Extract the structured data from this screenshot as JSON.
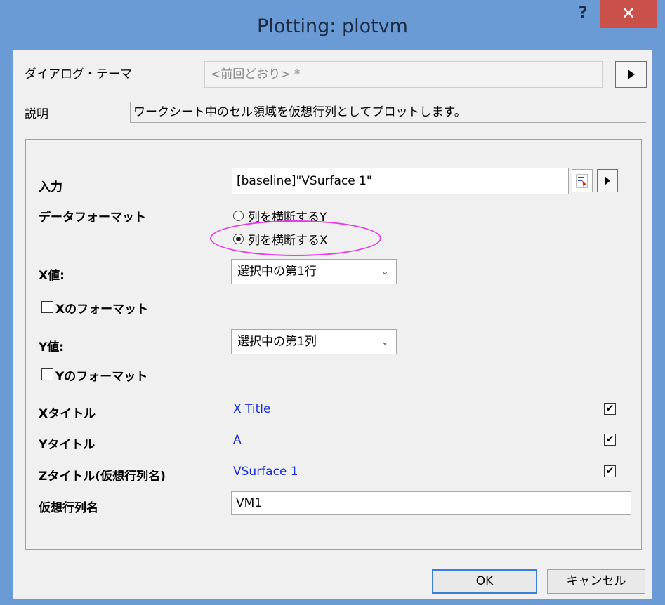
{
  "window": {
    "title": "Plotting: plotvm",
    "help_label": "?",
    "close_label": "✕"
  },
  "theme": {
    "label": "ダイアログ・テーマ",
    "value": "<前回どおり> *",
    "arrow_icon": "play-arrow-icon"
  },
  "description": {
    "label": "説明",
    "text": "ワークシート中のセル領域を仮想行列としてプロットします。"
  },
  "form": {
    "input_label": "入力",
    "input_value": "[baseline]\"VSurface 1\"",
    "data_format_label": "データフォーマット",
    "radio_y_label": "列を横断するY",
    "radio_x_label": "列を横断するX",
    "selected_format": "列を横断するX",
    "x_values_label": "X値:",
    "x_values_selected": "選択中の第1行",
    "x_format_label": "Xのフォーマット",
    "x_format_checked": false,
    "y_values_label": "Y値:",
    "y_values_selected": "選択中の第1列",
    "y_format_label": "Yのフォーマット",
    "y_format_checked": false,
    "x_title_label": "Xタイトル",
    "x_title_value": "X Title",
    "x_title_checked": true,
    "y_title_label": "Yタイトル",
    "y_title_value": "A",
    "y_title_checked": true,
    "z_title_label": "Zタイトル(仮想行列名)",
    "z_title_value": "VSurface 1",
    "z_title_checked": true,
    "vm_name_label": "仮想行列名",
    "vm_name_value": "VM1"
  },
  "buttons": {
    "ok": "OK",
    "cancel": "キャンセル"
  },
  "colors": {
    "accent": "#6b9bd4",
    "close": "#c9514a",
    "link_blue": "#1a2fd6",
    "highlight": "#e53be5"
  }
}
